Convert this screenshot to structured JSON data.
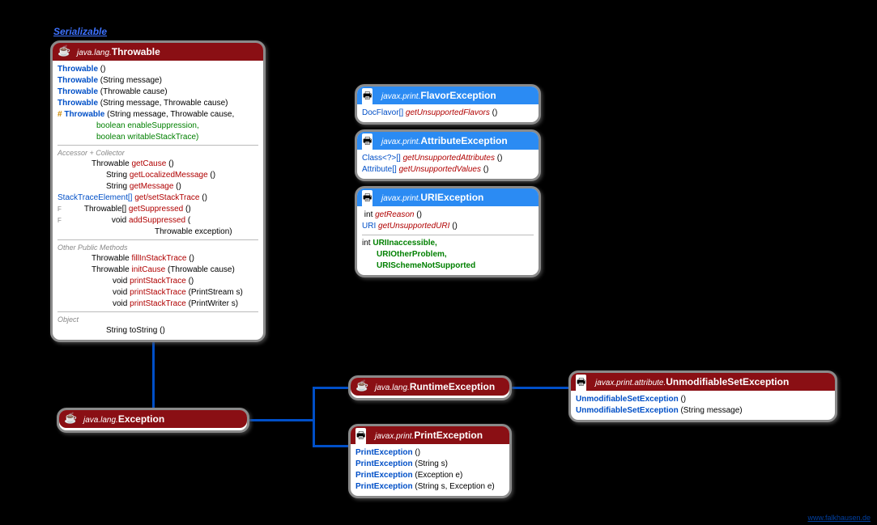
{
  "serializable": "Serializable",
  "footer": "www.falkhausen.de",
  "throwable": {
    "pkg": "java.lang.",
    "cls": "Throwable",
    "ctors": [
      {
        "name": "Throwable",
        "args": "()"
      },
      {
        "name": "Throwable",
        "args": "(String message)"
      },
      {
        "name": "Throwable",
        "args": "(Throwable cause)"
      },
      {
        "name": "Throwable",
        "args": "(String message, Throwable cause)"
      }
    ],
    "ctor5": {
      "prefix": "#",
      "name": "Throwable",
      "args": "(String message, Throwable cause,"
    },
    "ctor5b": "boolean enableSuppression,",
    "ctor5c": "boolean writableStackTrace)",
    "sec1": "Accessor + Collector",
    "acc": [
      {
        "ret": "Throwable",
        "name": "getCause",
        "args": "()"
      },
      {
        "ret": "String",
        "name": "getLocalizedMessage",
        "args": "()"
      },
      {
        "ret": "String",
        "name": "getMessage",
        "args": "()"
      },
      {
        "ret": "StackTraceElement[]",
        "name": "get/setStackTrace",
        "args": "()"
      },
      {
        "ret": "Throwable[]",
        "name": "getSuppressed",
        "args": "()",
        "final": true
      },
      {
        "ret": "void",
        "name": "addSuppressed",
        "args": "(",
        "final": true
      },
      {
        "ret": "",
        "name": "",
        "args": "Throwable exception)"
      }
    ],
    "sec2": "Other Public Methods",
    "pub": [
      {
        "ret": "Throwable",
        "name": "fillInStackTrace",
        "args": "()"
      },
      {
        "ret": "Throwable",
        "name": "initCause",
        "args": "(Throwable cause)"
      },
      {
        "ret": "void",
        "name": "printStackTrace",
        "args": "()"
      },
      {
        "ret": "void",
        "name": "printStackTrace",
        "args": "(PrintStream s)"
      },
      {
        "ret": "void",
        "name": "printStackTrace",
        "args": "(PrintWriter s)"
      }
    ],
    "sec3": "Object",
    "obj": {
      "ret": "String",
      "name": "toString",
      "args": "()"
    }
  },
  "flavor": {
    "pkg": "javax.print.",
    "cls": "FlavorException",
    "rows": [
      {
        "ret": "DocFlavor[]",
        "name": "getUnsupportedFlavors",
        "args": "()",
        "italic": true
      }
    ]
  },
  "attribute": {
    "pkg": "javax.print.",
    "cls": "AttributeException",
    "rows": [
      {
        "ret": "Class<?>[]",
        "name": "getUnsupportedAttributes",
        "args": "()",
        "italic": true
      },
      {
        "ret": "Attribute[]",
        "name": "getUnsupportedValues",
        "args": "()",
        "italic": true
      }
    ]
  },
  "uri": {
    "pkg": "javax.print.",
    "cls": "URIException",
    "rows": [
      {
        "ret": "int",
        "name": "getReason",
        "args": "()",
        "italic": true
      },
      {
        "ret": "URI",
        "name": "getUnsupportedURI",
        "args": "()",
        "italic": true
      }
    ],
    "consts_ret": "int",
    "consts": [
      "URIInaccessible,",
      "URIOtherProblem,",
      "URISchemeNotSupported"
    ]
  },
  "exception": {
    "pkg": "java.lang.",
    "cls": "Exception"
  },
  "runtime": {
    "pkg": "java.lang.",
    "cls": "RuntimeException"
  },
  "printexc": {
    "pkg": "javax.print.",
    "cls": "PrintException",
    "rows": [
      {
        "name": "PrintException",
        "args": "()"
      },
      {
        "name": "PrintException",
        "args": "(String s)"
      },
      {
        "name": "PrintException",
        "args": "(Exception e)"
      },
      {
        "name": "PrintException",
        "args": "(String s, Exception e)"
      }
    ]
  },
  "unmod": {
    "pkg": "javax.print.attribute.",
    "cls": "UnmodifiableSetException",
    "rows": [
      {
        "name": "UnmodifiableSetException",
        "args": "()"
      },
      {
        "name": "UnmodifiableSetException",
        "args": "(String message)"
      }
    ]
  }
}
